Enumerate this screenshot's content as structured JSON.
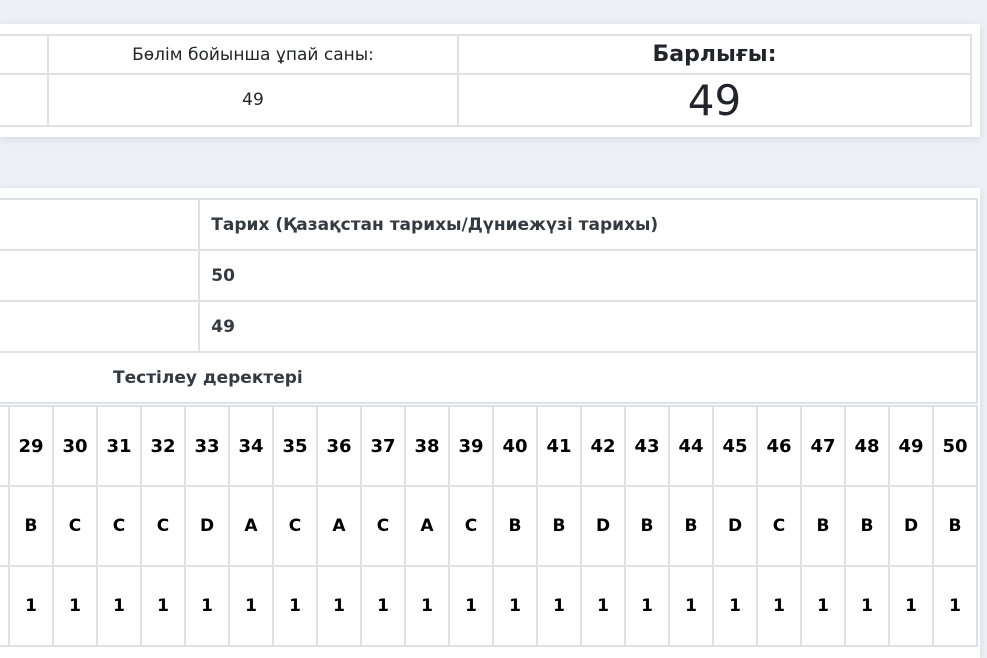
{
  "summary": {
    "section_score_label": "Бөлім бойынша ұпай саны:",
    "total_label": "Барлығы:",
    "section_score_value": "49",
    "total_value": "49"
  },
  "subject": {
    "name": "Тарих (Қазақстан тарихы/Дүниежүзі тарихы)",
    "max_score": "50",
    "score": "49",
    "testing_data_label": "Тестілеу деректері"
  },
  "answers": {
    "numbers": [
      "29",
      "30",
      "31",
      "32",
      "33",
      "34",
      "35",
      "36",
      "37",
      "38",
      "39",
      "40",
      "41",
      "42",
      "43",
      "44",
      "45",
      "46",
      "47",
      "48",
      "49",
      "50"
    ],
    "letters": [
      "B",
      "C",
      "C",
      "C",
      "D",
      "A",
      "C",
      "A",
      "C",
      "A",
      "C",
      "B",
      "B",
      "D",
      "B",
      "B",
      "D",
      "C",
      "B",
      "B",
      "D",
      "B"
    ],
    "points": [
      "1",
      "1",
      "1",
      "1",
      "1",
      "1",
      "1",
      "1",
      "1",
      "1",
      "1",
      "1",
      "1",
      "1",
      "1",
      "1",
      "1",
      "1",
      "1",
      "1",
      "1",
      "1"
    ]
  }
}
